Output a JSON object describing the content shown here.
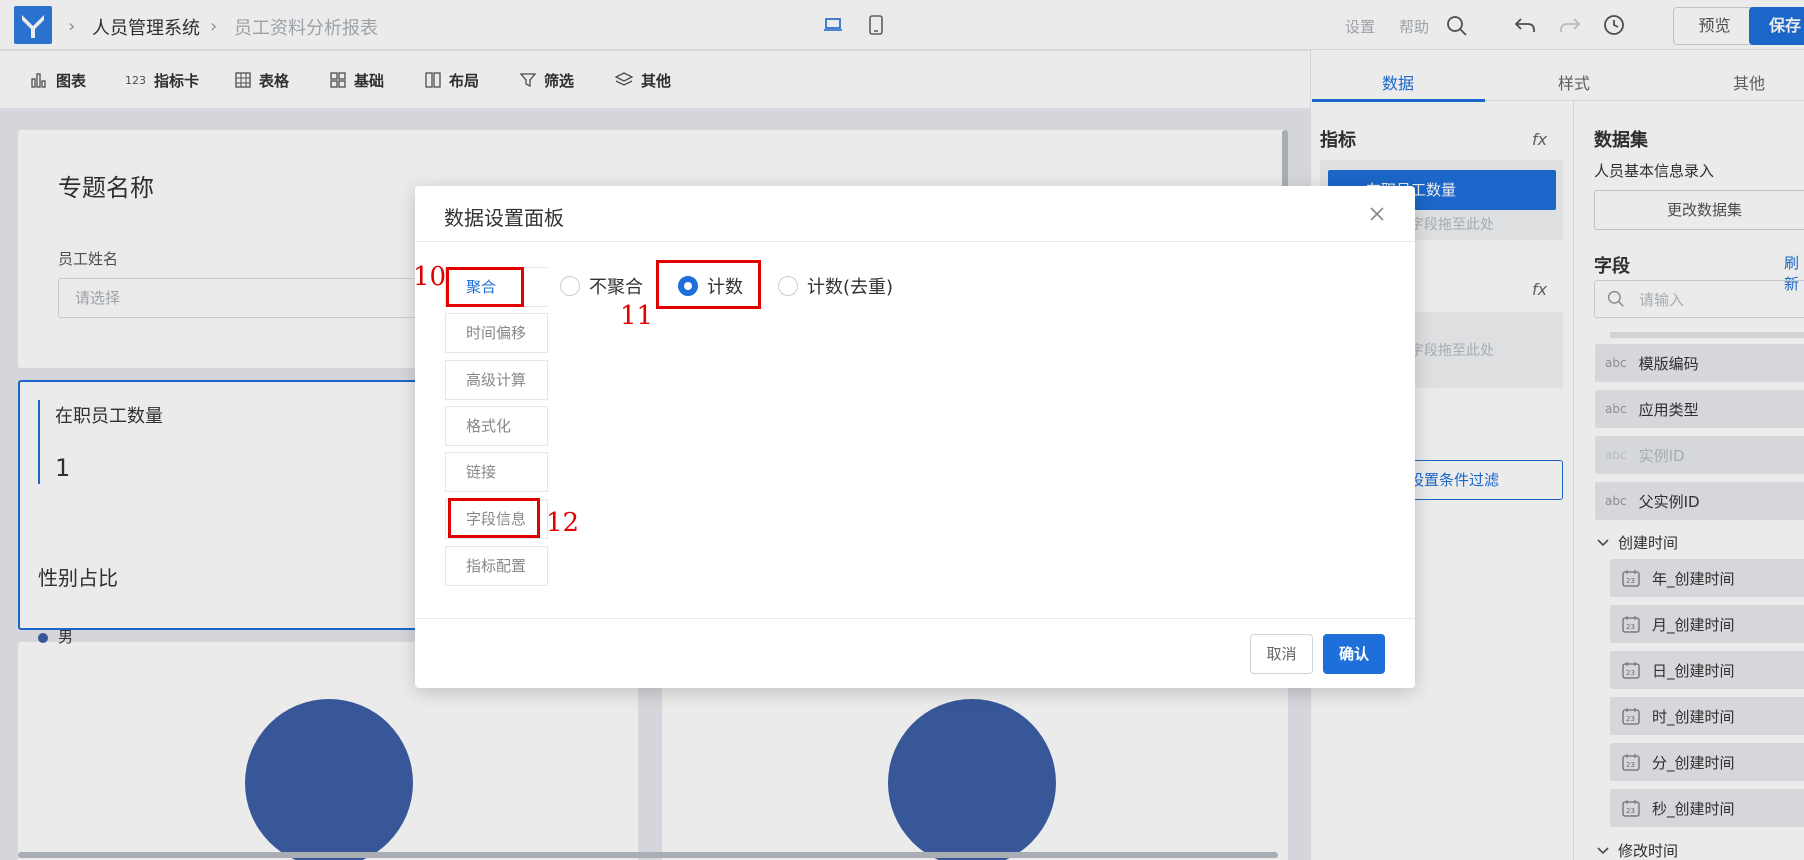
{
  "header": {
    "system_name": "人员管理系统",
    "report_name": "员工资料分析报表",
    "settings": "设置",
    "help": "帮助",
    "preview": "预览",
    "save": "保存"
  },
  "toolbar": [
    {
      "label": "图表",
      "icon": "bar-chart-icon"
    },
    {
      "label": "指标卡",
      "icon": "metric-card-icon"
    },
    {
      "label": "表格",
      "icon": "table-icon"
    },
    {
      "label": "基础",
      "icon": "grid-icon"
    },
    {
      "label": "布局",
      "icon": "layout-icon"
    },
    {
      "label": "筛选",
      "icon": "filter-icon"
    },
    {
      "label": "其他",
      "icon": "layers-icon"
    }
  ],
  "canvas": {
    "topic_title": "专题名称",
    "filter_label": "员工姓名",
    "filter_placeholder": "请选择",
    "metric_title": "在职员工数量",
    "metric_value": "1",
    "gender_title": "性别占比",
    "gender_legend": "男",
    "pie_color": "#3d5fa7"
  },
  "right_panel": {
    "tabs": [
      "数据",
      "样式",
      "其他"
    ],
    "metric_header": "指标",
    "metric_chip": "在职员工数量",
    "drop_hint": "字段拖至此处",
    "drop_hint2": "字段拖至此处",
    "filter_button": "设置条件过滤",
    "dataset_header": "数据集",
    "dataset_name": "人员基本信息录入",
    "change_dataset": "更改数据集",
    "fields_header": "字段",
    "refresh": "刷新",
    "search_placeholder": "请输入",
    "fields": [
      {
        "type": "abc",
        "name": "模版编码"
      },
      {
        "type": "abc",
        "name": "应用类型"
      },
      {
        "type": "abc",
        "name": "实例ID"
      },
      {
        "type": "abc",
        "name": "父实例ID"
      }
    ],
    "group_create": "创建时间",
    "create_subfields": [
      "年_创建时间",
      "月_创建时间",
      "日_创建时间",
      "时_创建时间",
      "分_创建时间",
      "秒_创建时间"
    ],
    "group_modify": "修改时间"
  },
  "modal": {
    "title": "数据设置面板",
    "side_tabs": [
      "聚合",
      "时间偏移",
      "高级计算",
      "格式化",
      "链接",
      "字段信息",
      "指标配置"
    ],
    "radios": [
      "不聚合",
      "计数",
      "计数(去重)"
    ],
    "selected_radio": "计数",
    "cancel": "取消",
    "confirm": "确认"
  },
  "annotations": {
    "a10": "10",
    "a11": "11",
    "a12": "12"
  },
  "colors": {
    "accent": "#1e6fd9",
    "annotation": "#e00000"
  }
}
